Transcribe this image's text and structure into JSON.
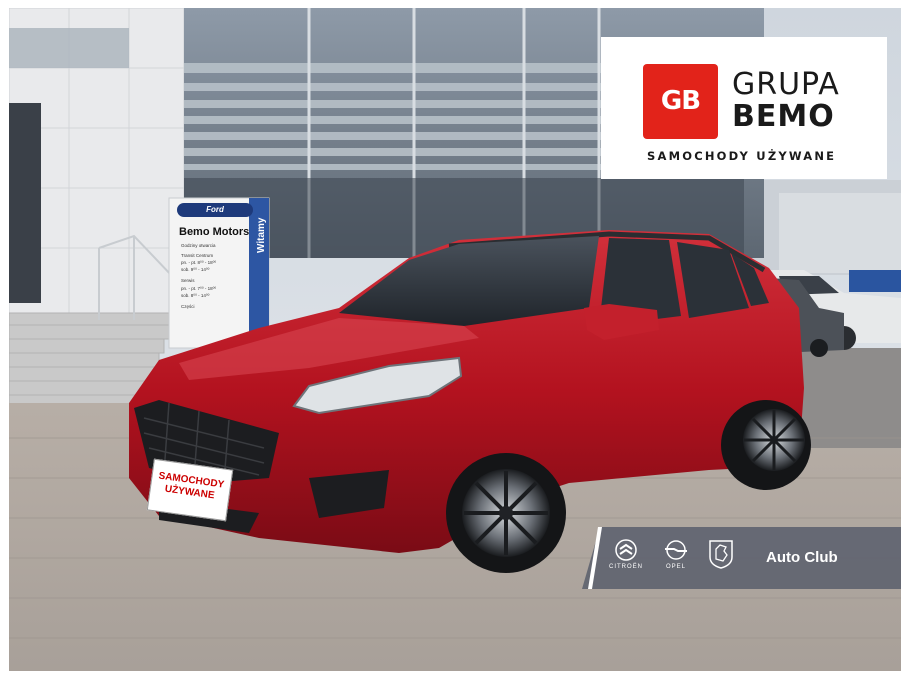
{
  "logo": {
    "mark": "GB",
    "line1": "GRUPA",
    "line2": "BEMO",
    "tagline": "SAMOCHODY UŻYWANE"
  },
  "brand_bar": {
    "brands": [
      "CITROËN",
      "OPEL",
      "PEUGEOT"
    ],
    "auto_club": "Auto Club"
  },
  "dealer_pylon": {
    "brand": "Ford",
    "title": "Bemo Motors",
    "side_text": "Witamy",
    "small_lines": [
      "Godziny otwarcia",
      "Transit Centrum",
      "pn. - pt.  8⁰⁰ - 18⁰⁰",
      "sob.  9⁰⁰ - 14⁰⁰",
      "Serwis",
      "pn. - pt.  7⁰⁰ - 18⁰⁰",
      "sob.  8⁰⁰ - 14⁰⁰",
      "Części"
    ]
  },
  "plate": {
    "line1": "SAMOCHODY",
    "line2": "UŻYWANE"
  },
  "colors": {
    "brand_red": "#e2231a",
    "car_red": "#b3121f",
    "banner_grey": "#5f6470"
  }
}
